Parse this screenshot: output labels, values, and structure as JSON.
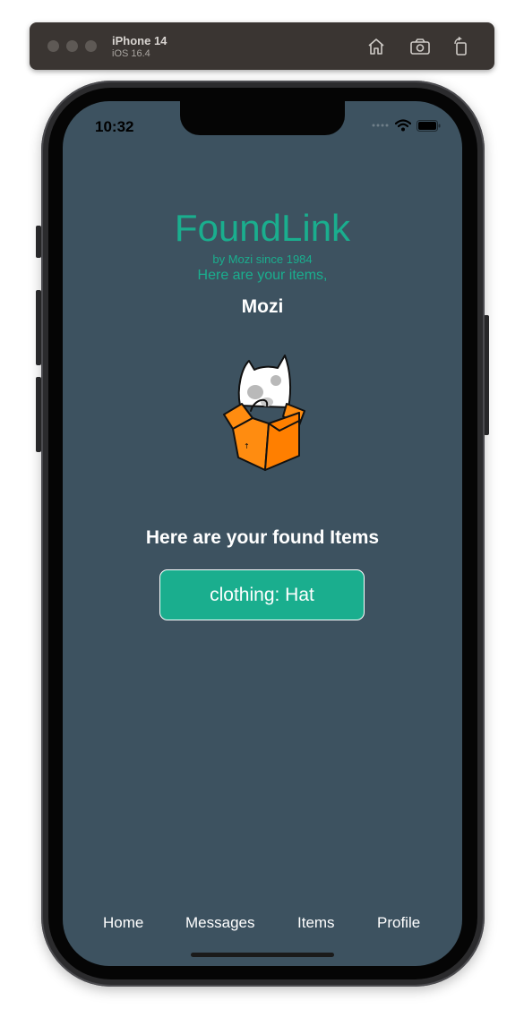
{
  "simulator": {
    "device": "iPhone 14",
    "os": "iOS 16.4"
  },
  "status_bar": {
    "time": "10:32"
  },
  "app": {
    "brand": "FoundLink",
    "byline": "by Mozi since 1984",
    "greeting": "Here are your items,",
    "username": "Mozi",
    "found_heading": "Here are your found Items",
    "items": [
      {
        "label": "clothing: Hat"
      }
    ]
  },
  "tabs": [
    {
      "label": "Home"
    },
    {
      "label": "Messages"
    },
    {
      "label": "Items"
    },
    {
      "label": "Profile"
    }
  ],
  "colors": {
    "screen_bg": "#3d5260",
    "accent": "#1aae8e",
    "box_orange": "#ff7f00"
  }
}
